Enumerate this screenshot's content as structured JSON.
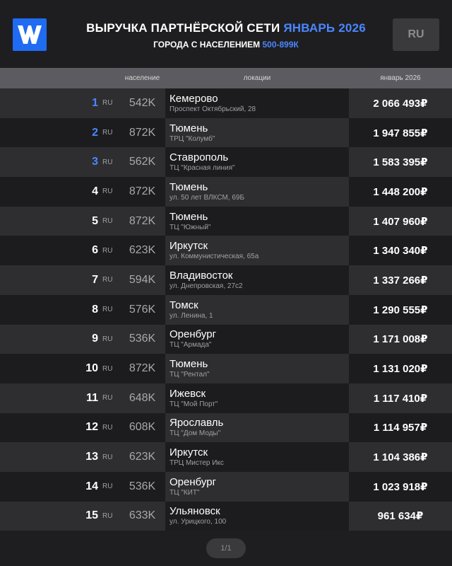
{
  "header": {
    "title_main": "ВЫРУЧКА ПАРТНЁРСКОЙ СЕТИ",
    "title_accent": "ЯНВАРЬ 2026",
    "subtitle_main": "ГОРОДА С НАСЕЛЕНИЕМ",
    "subtitle_accent": "500-899К",
    "lang_button": "RU",
    "accent_color": "#4a86ff",
    "logo_color": "#1f6bf2"
  },
  "columns": {
    "population": "население",
    "locations": "локации",
    "revenue": "январь 2026"
  },
  "rows": [
    {
      "rank": "1",
      "cc": "RU",
      "pop": "542K",
      "city": "Кемерово",
      "addr": "Проспект Октябрьский, 28",
      "rev": "2 066 493₽"
    },
    {
      "rank": "2",
      "cc": "RU",
      "pop": "872K",
      "city": "Тюмень",
      "addr": "ТРЦ \"Колумб\"",
      "rev": "1 947 855₽"
    },
    {
      "rank": "3",
      "cc": "RU",
      "pop": "562K",
      "city": "Ставрополь",
      "addr": "ТЦ \"Красная линия\"",
      "rev": "1 583 395₽"
    },
    {
      "rank": "4",
      "cc": "RU",
      "pop": "872K",
      "city": "Тюмень",
      "addr": "ул. 50 лет ВЛКСМ, 69Б",
      "rev": "1 448 200₽"
    },
    {
      "rank": "5",
      "cc": "RU",
      "pop": "872K",
      "city": "Тюмень",
      "addr": "ТЦ \"Южный\"",
      "rev": "1 407 960₽"
    },
    {
      "rank": "6",
      "cc": "RU",
      "pop": "623K",
      "city": "Иркутск",
      "addr": "ул. Коммунистическая, 65а",
      "rev": "1 340 340₽"
    },
    {
      "rank": "7",
      "cc": "RU",
      "pop": "594K",
      "city": "Владивосток",
      "addr": "ул. Днепровская, 27с2",
      "rev": "1 337 266₽"
    },
    {
      "rank": "8",
      "cc": "RU",
      "pop": "576K",
      "city": "Томск",
      "addr": "ул. Ленина, 1",
      "rev": "1 290 555₽"
    },
    {
      "rank": "9",
      "cc": "RU",
      "pop": "536K",
      "city": "Оренбург",
      "addr": "ТЦ \"Армада\"",
      "rev": "1 171 008₽"
    },
    {
      "rank": "10",
      "cc": "RU",
      "pop": "872K",
      "city": "Тюмень",
      "addr": "ТЦ \"Рентал\"",
      "rev": "1 131 020₽"
    },
    {
      "rank": "11",
      "cc": "RU",
      "pop": "648K",
      "city": "Ижевск",
      "addr": "ТЦ \"Мой Порт\"",
      "rev": "1 117 410₽"
    },
    {
      "rank": "12",
      "cc": "RU",
      "pop": "608K",
      "city": "Ярославль",
      "addr": "ТЦ \"Дом Моды\"",
      "rev": "1 114 957₽"
    },
    {
      "rank": "13",
      "cc": "RU",
      "pop": "623K",
      "city": "Иркутск",
      "addr": "ТРЦ Мистер Икс",
      "rev": "1 104 386₽"
    },
    {
      "rank": "14",
      "cc": "RU",
      "pop": "536K",
      "city": "Оренбург",
      "addr": "ТЦ \"КИТ\"",
      "rev": "1 023 918₽"
    },
    {
      "rank": "15",
      "cc": "RU",
      "pop": "633K",
      "city": "Ульяновск",
      "addr": "ул. Урицкого, 100",
      "rev": "961 634₽"
    }
  ],
  "pager": {
    "label": "1/1"
  }
}
